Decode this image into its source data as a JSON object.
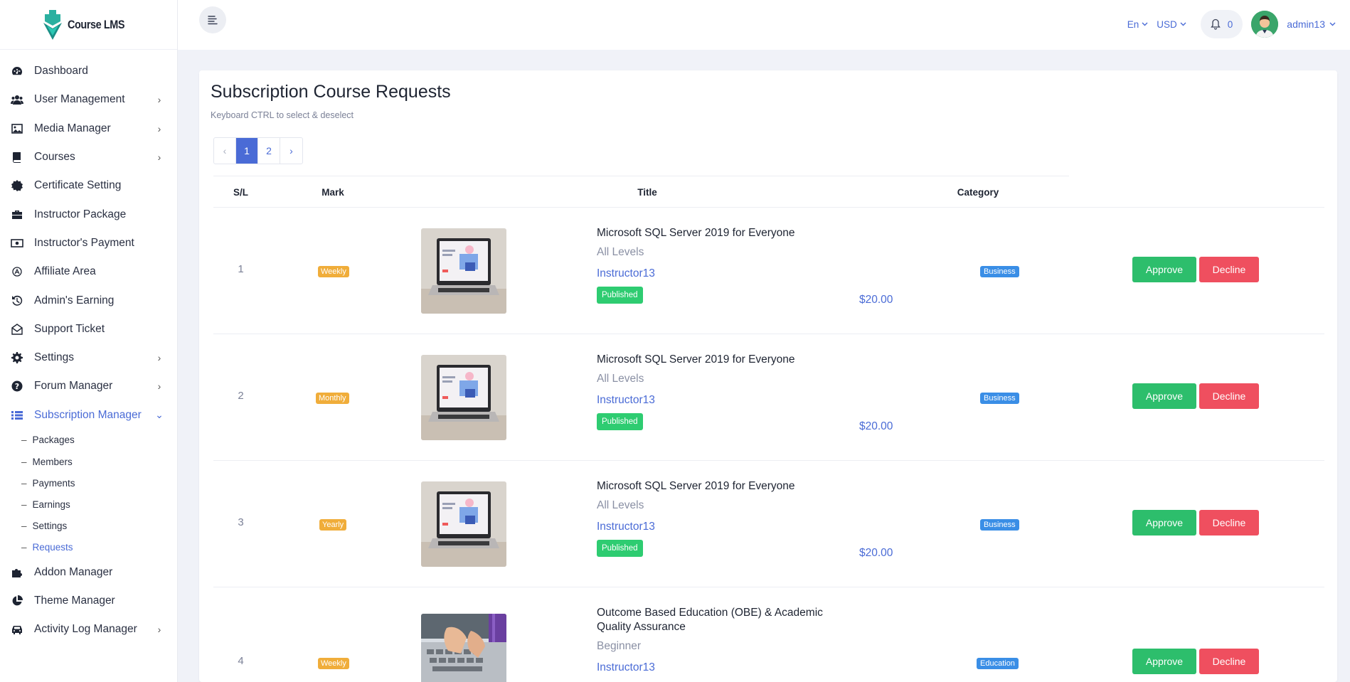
{
  "brand": {
    "name": "Course LMS"
  },
  "sidebar": {
    "items": [
      {
        "label": "Dashboard",
        "icon": "dashboard-icon"
      },
      {
        "label": "User Management",
        "icon": "users-icon"
      },
      {
        "label": "Media Manager",
        "icon": "image-icon"
      },
      {
        "label": "Courses",
        "icon": "book-icon"
      },
      {
        "label": "Certificate Setting",
        "icon": "certificate-icon"
      },
      {
        "label": "Instructor Package",
        "icon": "briefcase-icon"
      },
      {
        "label": "Instructor's Payment",
        "icon": "money-icon"
      },
      {
        "label": "Affiliate Area",
        "icon": "affiliate-icon"
      },
      {
        "label": "Admin's Earning",
        "icon": "history-icon"
      },
      {
        "label": "Support Ticket",
        "icon": "envelope-open-icon"
      },
      {
        "label": "Settings",
        "icon": "gear-icon"
      },
      {
        "label": "Forum Manager",
        "icon": "question-icon"
      },
      {
        "label": "Subscription Manager",
        "icon": "list-icon"
      }
    ],
    "subitems": [
      "Packages",
      "Members",
      "Payments",
      "Earnings",
      "Settings",
      "Requests"
    ],
    "bottom_items": [
      {
        "label": "Addon Manager",
        "icon": "puzzle-icon"
      },
      {
        "label": "Theme Manager",
        "icon": "pie-icon"
      },
      {
        "label": "Activity Log Manager",
        "icon": "car-icon"
      }
    ]
  },
  "topbar": {
    "language": "En",
    "currency": "USD",
    "notifications": "0",
    "username": "admin13"
  },
  "page": {
    "title": "Subscription Course Requests",
    "subtitle": "Keyboard CTRL to select & deselect"
  },
  "pagination": {
    "prev": "‹",
    "pages": [
      "1",
      "2"
    ],
    "next": "›",
    "current": "1"
  },
  "table": {
    "headers": {
      "sl": "S/L",
      "mark": "Mark",
      "title": "Title",
      "category": "Category"
    },
    "rows": [
      {
        "sl": "1",
        "mark": "Weekly",
        "title": "Microsoft SQL Server 2019 for Everyone",
        "level": "All Levels",
        "instructor": "Instructor13",
        "status": "Published",
        "price": "$20.00",
        "category": "Business",
        "approve": "Approve",
        "decline": "Decline"
      },
      {
        "sl": "2",
        "mark": "Monthly",
        "title": "Microsoft SQL Server 2019 for Everyone",
        "level": "All Levels",
        "instructor": "Instructor13",
        "status": "Published",
        "price": "$20.00",
        "category": "Business",
        "approve": "Approve",
        "decline": "Decline"
      },
      {
        "sl": "3",
        "mark": "Yearly",
        "title": "Microsoft SQL Server 2019 for Everyone",
        "level": "All Levels",
        "instructor": "Instructor13",
        "status": "Published",
        "price": "$20.00",
        "category": "Business",
        "approve": "Approve",
        "decline": "Decline"
      },
      {
        "sl": "4",
        "mark": "Weekly",
        "title": "Outcome Based Education (OBE) & Academic Quality Assurance",
        "level": "Beginner",
        "instructor": "Instructor13",
        "status": "",
        "price": "",
        "category": "Education",
        "approve": "Approve",
        "decline": "Decline"
      }
    ]
  },
  "colors": {
    "accent": "#4a6bd6",
    "approve": "#2dbe6c",
    "decline": "#ef4f5f",
    "mark": "#f0ad3a",
    "published": "#2ecc71",
    "category": "#3a8ee6"
  }
}
